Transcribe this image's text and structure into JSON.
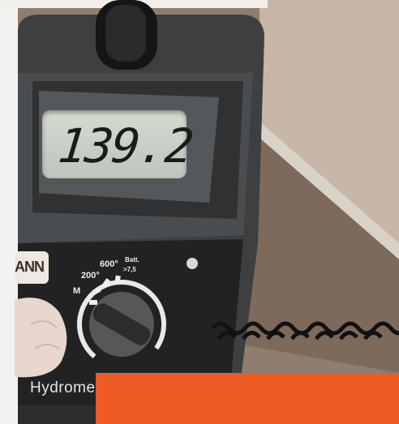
{
  "meter": {
    "display_reading": "139.2",
    "logo_text": "ANN",
    "brand_text": "Hydrome",
    "dial_labels": {
      "m": "M",
      "p200": "200°",
      "p600": "600°",
      "batt": "Batt.",
      "gt75": ">7,5"
    }
  },
  "colors": {
    "housing": "#3a3c3d",
    "lcd": "#c9cfc6",
    "sticker": "#ef5b25",
    "wood": "#8d7b6c"
  }
}
